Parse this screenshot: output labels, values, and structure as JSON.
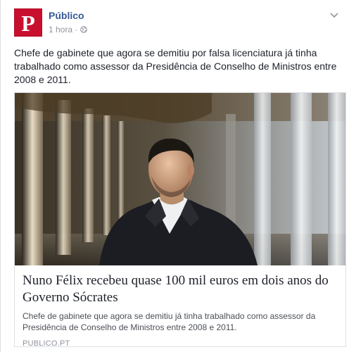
{
  "page": {
    "name": "Público",
    "avatar_letter": "P",
    "time": "1 hora",
    "separator": "·",
    "visibility_icon": "globe-icon",
    "menu_icon": "chevron-down-icon"
  },
  "post": {
    "text": "Chefe de gabinete que agora se demitiu por falsa licenciatura já tinha trabalhado como assessor da Presidência de Conselho de Ministros entre 2008 e 2011."
  },
  "link": {
    "title": "Nuno Félix recebeu quase 100 mil euros em dois anos do Governo Sócrates",
    "description": "Chefe de gabinete que agora se demitiu já tinha trabalhado como assessor da Presidência de Conselho de Ministros entre 2008 e 2011.",
    "domain": "PUBLICO.PT"
  },
  "colors": {
    "brand": "#c8102e",
    "link_blue": "#365899",
    "meta_gray": "#90949c"
  }
}
